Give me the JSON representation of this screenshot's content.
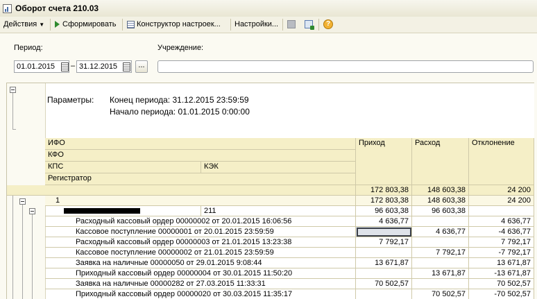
{
  "window": {
    "title": "Оборот счета 210.03"
  },
  "toolbar": {
    "actions": "Действия",
    "generate": "Сформировать",
    "constructor": "Конструктор настроек...",
    "settings": "Настройки..."
  },
  "filters": {
    "period_label": "Период:",
    "period_from": "01.01.2015",
    "period_dash": "–",
    "period_to": "31.12.2015",
    "dots": "...",
    "institution_label": "Учреждение:",
    "institution_value": ""
  },
  "report": {
    "params_label": "Параметры:",
    "period_end": "Конец периода: 31.12.2015 23:59:59",
    "period_start": "Начало периода: 01.01.2015 0:00:00",
    "headers": {
      "ifo": "ИФО",
      "kfo": "КФО",
      "kps": "КПС",
      "kek": "КЭК",
      "registrar": "Регистратор",
      "income": "Приход",
      "expense": "Расход",
      "deviation": "Отклонение"
    },
    "total": {
      "label": "",
      "income": "172 803,38",
      "expense": "148 603,38",
      "deviation": "24 200"
    },
    "group1": {
      "label": "1",
      "income": "172 803,38",
      "expense": "148 603,38",
      "deviation": "24 200"
    },
    "group2": {
      "kek": "211",
      "income": "96 603,38",
      "expense": "96 603,38",
      "deviation": ""
    },
    "rows": [
      {
        "label": "Расходный кассовый ордер 00000002 от 20.01.2015 16:06:56",
        "income": "4 636,77",
        "expense": "",
        "deviation": "4 636,77"
      },
      {
        "label": "Кассовое поступление 00000001 от 20.01.2015 23:59:59",
        "income": "",
        "expense": "4 636,77",
        "deviation": "-4 636,77"
      },
      {
        "label": "Расходный кассовый ордер 00000003 от 21.01.2015 13:23:38",
        "income": "7 792,17",
        "expense": "",
        "deviation": "7 792,17"
      },
      {
        "label": "Кассовое поступление 00000002 от 21.01.2015 23:59:59",
        "income": "",
        "expense": "7 792,17",
        "deviation": "-7 792,17"
      },
      {
        "label": "Заявка на наличные 00000050 от 29.01.2015 9:08:44",
        "income": "13 671,87",
        "expense": "",
        "deviation": "13 671,87"
      },
      {
        "label": "Приходный кассовый ордер 00000004 от 30.01.2015 11:50:20",
        "income": "",
        "expense": "13 671,87",
        "deviation": "-13 671,87"
      },
      {
        "label": "Заявка на наличные 00000282 от 27.03.2015 11:33:31",
        "income": "70 502,57",
        "expense": "",
        "deviation": "70 502,57"
      },
      {
        "label": "Приходный кассовый ордер 00000020 от 30.03.2015 11:35:17",
        "income": "",
        "expense": "70 502,57",
        "deviation": "-70 502,57"
      }
    ]
  }
}
